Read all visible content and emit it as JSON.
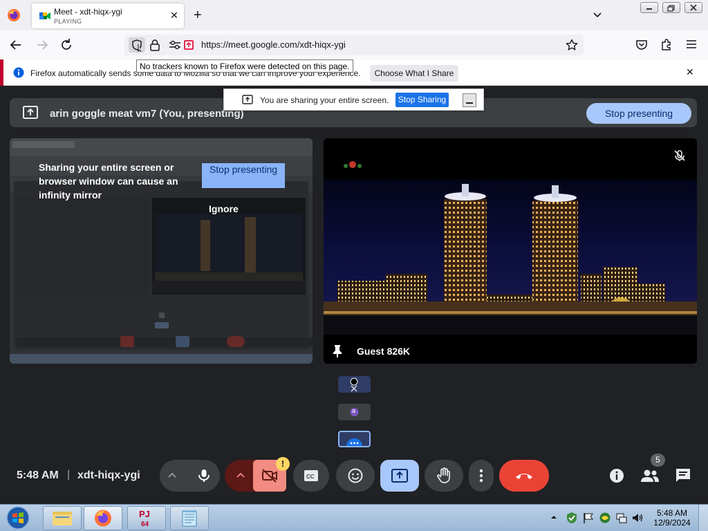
{
  "browser": {
    "tab": {
      "title": "Meet - xdt-hiqx-ygi",
      "subtitle": "PLAYING"
    },
    "url": "https://meet.google.com/xdt-hiqx-ygi",
    "tooltip": "No trackers known to Firefox were detected on this page.",
    "notification": {
      "text": "Firefox automatically sends some data to Mozilla so that we can improve your experience.",
      "button": "Choose What I Share"
    }
  },
  "share_popup": {
    "text": "You are sharing your entire screen.",
    "stop_button": "Stop Sharing"
  },
  "meet": {
    "presenting_title": "arin goggle meat vm7 (You, presenting)",
    "stop_presenting_label": "Stop presenting",
    "mirror_warning": {
      "text": "Sharing your entire screen or browser window can cause an infinity mirror",
      "stop_label": "Stop presenting",
      "ignore_label": "Ignore"
    },
    "guest_tile": {
      "name": "Guest 826K"
    },
    "mini_tile_avatar": "a",
    "footer": {
      "time": "5:48 AM",
      "separator": "|",
      "meeting_code": "xdt-hiqx-ygi",
      "participants_count": "5",
      "camera_alert": "!"
    },
    "colors": {
      "end_call": "#ea4335",
      "present_active": "#a8c7fa",
      "camera_off": "#f28b82",
      "accent_blue": "#1a73e8"
    }
  },
  "taskbar": {
    "pinned": [
      "explorer-icon",
      "firefox-icon",
      "pj64-icon",
      "notepad-icon"
    ],
    "pj64_label": "PJ\n64",
    "clock_time": "5:48 AM",
    "clock_date": "12/9/2024"
  }
}
